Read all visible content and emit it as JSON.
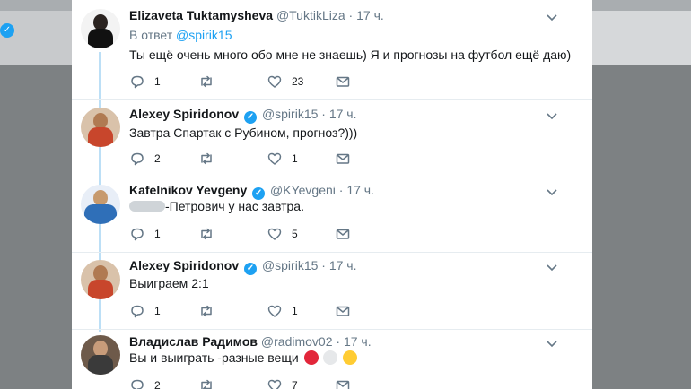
{
  "tweets": [
    {
      "name": "Elizaveta Tuktamysheva",
      "verified": false,
      "handle": "@TuktikLiza",
      "dot": "·",
      "time": "17 ч.",
      "reply_prefix": "В ответ",
      "reply_handle": "@spirik15",
      "text": "Ты ещё очень много обо мне не знаешь) Я и прогнозы на футбол ещё даю)",
      "replies": "1",
      "retweets": "",
      "likes": "23"
    },
    {
      "name": "Alexey Spiridonov",
      "verified": true,
      "handle": "@spirik15",
      "dot": "·",
      "time": "17 ч.",
      "text": "Завтра Спартак с Рубином, прогноз?)))",
      "replies": "2",
      "retweets": "",
      "likes": "1"
    },
    {
      "name": "Kafelnikov Yevgeny",
      "verified": true,
      "handle": "@KYevgeni",
      "dot": "·",
      "time": "17 ч.",
      "text": "-Петрович у нас завтра.",
      "replies": "1",
      "retweets": "",
      "likes": "5"
    },
    {
      "name": "Alexey Spiridonov",
      "verified": true,
      "handle": "@spirik15",
      "dot": "·",
      "time": "17 ч.",
      "text": "Выиграем 2:1",
      "replies": "1",
      "retweets": "",
      "likes": "1"
    },
    {
      "name": "Владислав Радимов",
      "verified": false,
      "handle": "@radimov02",
      "dot": "·",
      "time": "17 ч.",
      "text": "Вы и выиграть -разные вещи",
      "replies": "2",
      "retweets": "",
      "likes": "7"
    }
  ],
  "icons": {
    "reply": "reply-icon",
    "retweet": "retweet-icon",
    "like": "heart-icon",
    "dm": "envelope-icon",
    "menu": "chevron-down-icon",
    "verified": "verified-badge-icon"
  },
  "colors": {
    "accent": "#1da1f2",
    "thread_line": "#bcdff6",
    "muted": "#657786",
    "text": "#14171a"
  }
}
